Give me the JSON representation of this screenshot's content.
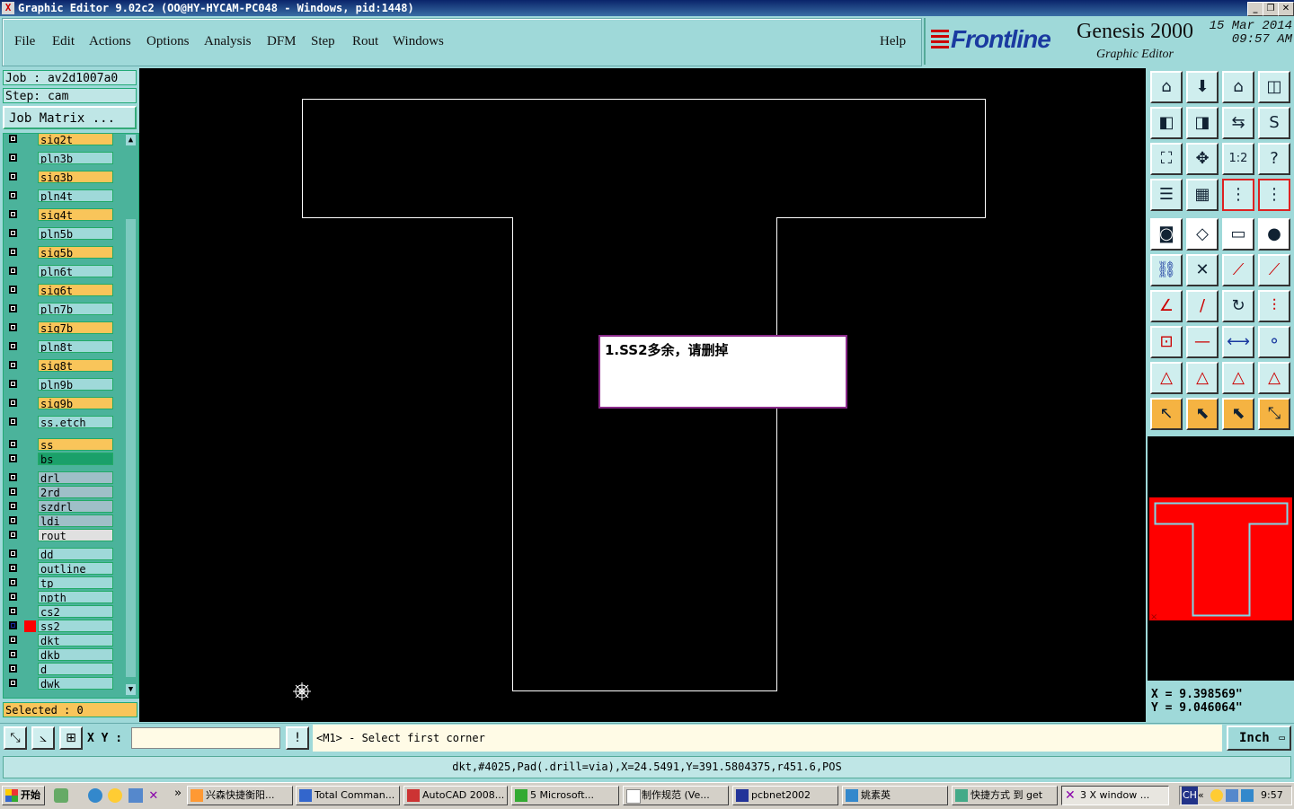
{
  "window": {
    "title": "Graphic Editor 9.02c2  (OO@HY-HYCAM-PC048 - Windows, pid:1448)",
    "min": "_",
    "restore": "❐",
    "close": "✕"
  },
  "menu": [
    "File",
    "Edit",
    "Actions",
    "Options",
    "Analysis",
    "DFM",
    "Step",
    "Rout",
    "Windows"
  ],
  "help": "Help",
  "brand": {
    "logo": "Frontline",
    "product": "Genesis 2000",
    "subtitle": "Graphic Editor",
    "date": "15 Mar 2014",
    "time": "09:57 AM"
  },
  "job": {
    "job_line": "Job : av2d1007a0",
    "step_line": "Step: cam",
    "matrix_button": "Job Matrix ..."
  },
  "layers": [
    {
      "name": "sig2t",
      "color": "#f9c55a"
    },
    {
      "name": "pln3b",
      "color": "#9fd9d9"
    },
    {
      "name": "sig3b",
      "color": "#f9c55a"
    },
    {
      "name": "pln4t",
      "color": "#9fd9d9"
    },
    {
      "name": "sig4t",
      "color": "#f9c55a"
    },
    {
      "name": "pln5b",
      "color": "#9fd9d9"
    },
    {
      "name": "sig5b",
      "color": "#f9c55a"
    },
    {
      "name": "pln6t",
      "color": "#9fd9d9"
    },
    {
      "name": "sig6t",
      "color": "#f9c55a"
    },
    {
      "name": "pln7b",
      "color": "#9fd9d9"
    },
    {
      "name": "sig7b",
      "color": "#f9c55a"
    },
    {
      "name": "pln8t",
      "color": "#9fd9d9"
    },
    {
      "name": "sig8t",
      "color": "#f9c55a"
    },
    {
      "name": "pln9b",
      "color": "#9fd9d9"
    },
    {
      "name": "sig9b",
      "color": "#f9c55a"
    },
    {
      "name": "ss.etch",
      "color": "#9fd9d9"
    },
    {
      "name": "ss",
      "color": "#f9c55a"
    },
    {
      "name": "bs",
      "color": "#1aa06a"
    },
    {
      "name": "drl",
      "color": "#9fbfc8"
    },
    {
      "name": "2rd",
      "color": "#9fbfc8"
    },
    {
      "name": "szdrl",
      "color": "#9fbfc8"
    },
    {
      "name": "ldi",
      "color": "#9fbfc8"
    },
    {
      "name": "rout",
      "color": "#e0e0e0"
    },
    {
      "name": "dd",
      "color": "#9fd9d9"
    },
    {
      "name": "outline",
      "color": "#9fd9d9"
    },
    {
      "name": "tp",
      "color": "#9fd9d9"
    },
    {
      "name": "npth",
      "color": "#9fd9d9"
    },
    {
      "name": "cs2",
      "color": "#9fd9d9"
    },
    {
      "name": "ss2",
      "color": "#9fd9d9",
      "active": true
    },
    {
      "name": "dkt",
      "color": "#9fd9d9"
    },
    {
      "name": "dkb",
      "color": "#9fd9d9"
    },
    {
      "name": "d",
      "color": "#9fd9d9"
    },
    {
      "name": "dwk",
      "color": "#9fd9d9"
    }
  ],
  "selected": "Selected : 0",
  "note": "1.SS2多余，请删掉",
  "coords": {
    "x": "X = 9.398569\"",
    "y": "Y = 9.046064\""
  },
  "xy_label": "X Y :",
  "xy_input": "",
  "prompt": "<M1> - Select first corner",
  "unit": "Inch",
  "status": "dkt,#4025,Pad(.drill=via),X=24.5491,Y=391.5804375,r451.6,POS",
  "colors": {
    "canvas": "#000000",
    "preview_fill": "#ff0000",
    "panel": "#9fd9d9"
  },
  "taskbar": {
    "start": "开始",
    "chevron": "»",
    "items": [
      "兴森快捷衡阳...",
      "Total Comman...",
      "AutoCAD 2008...",
      "5 Microsoft...",
      "制作规范 (Ve...",
      "pcbnet2002",
      "姚素英",
      "快捷方式 到 get",
      "3 X window ..."
    ],
    "tray_lang": "CH",
    "tray_chevron": "«",
    "clock": "9:57"
  }
}
